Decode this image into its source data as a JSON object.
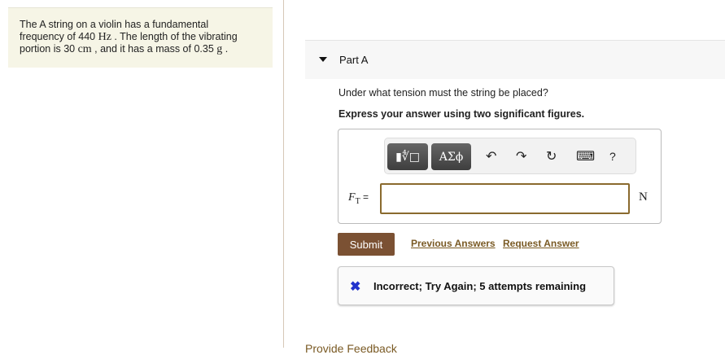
{
  "problem": {
    "t1": "The A string on a violin has a fundamental",
    "t2": "frequency of 440 ",
    "u1": "Hz",
    "t3": " . The length of the vibrating",
    "t4": "portion is 30 ",
    "u2": "cm",
    "t5": " , and it has a mass of 0.35 ",
    "u3": "g",
    "t6": " ."
  },
  "part": {
    "title": "Part A",
    "question": "Under what tension must the string be placed?",
    "instruction": "Express your answer using two significant figures."
  },
  "toolbar": {
    "templates": "▮∜□",
    "symbols": "ΑΣϕ",
    "undo": "↶",
    "redo": "↷",
    "reset": "↻",
    "keyboard": "⌨",
    "help": "?"
  },
  "answer": {
    "label": "F",
    "sub": "T",
    "eq": " =",
    "value": "",
    "unit": "N"
  },
  "actions": {
    "submit": "Submit",
    "previous": "Previous Answers",
    "request": "Request Answer"
  },
  "feedback": {
    "icon": "✖",
    "text": "Incorrect; Try Again; 5 attempts remaining"
  },
  "footer": {
    "provide": "Provide Feedback"
  }
}
